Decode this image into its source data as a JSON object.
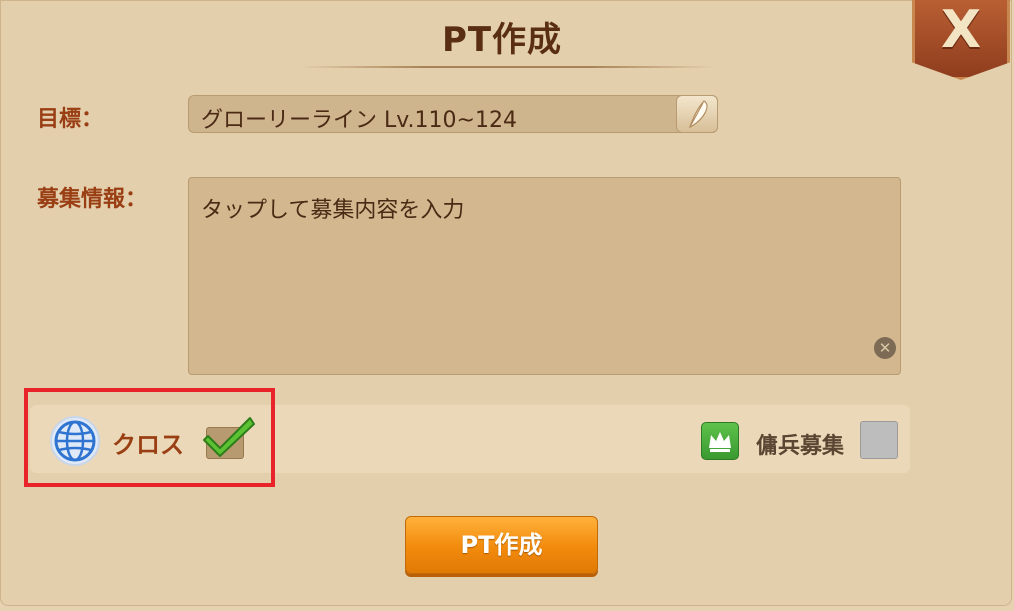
{
  "header": {
    "title": "PT作成",
    "close_icon_glyph": "X"
  },
  "form": {
    "target_label": "目標：",
    "target_value": "グローリーライン Lv.110~124",
    "info_label": "募集情報：",
    "info_placeholder": "タップして募集内容を入力",
    "clear_glyph": "✕"
  },
  "options": {
    "cross_label": "クロス",
    "cross_checked": true,
    "mercenary_label": "傭兵募集",
    "mercenary_checked": false
  },
  "footer": {
    "create_button_label": "PT作成"
  },
  "colors": {
    "highlight": "#e8232a",
    "accent_orange": "#f28a0c",
    "label_brown": "#9a3e14"
  }
}
